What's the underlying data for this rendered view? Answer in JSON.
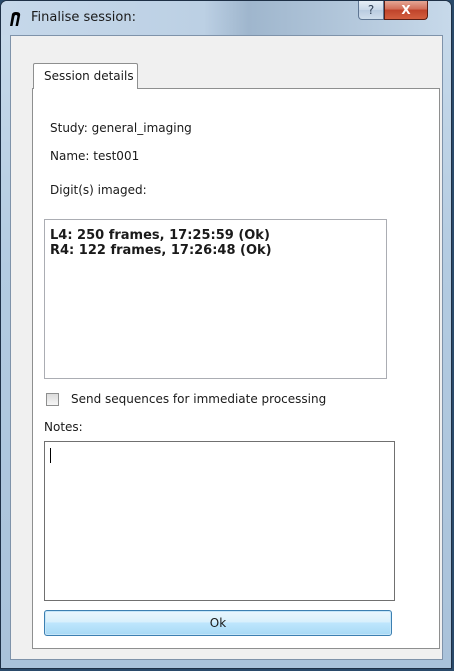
{
  "window": {
    "title": "Finalise session:",
    "app_icon": "n-logo-icon",
    "help_label": "?",
    "close_label": "X"
  },
  "tabs": [
    {
      "label": "Session details",
      "active": true
    }
  ],
  "session": {
    "study": "Study: general_imaging",
    "name": "Name: test001",
    "digits_label": "Digit(s) imaged:",
    "digits": [
      "L4: 250 frames, 17:25:59 (Ok)",
      "R4: 122 frames, 17:26:48 (Ok)"
    ],
    "send_checkbox_label": "Send sequences for immediate processing",
    "send_checked": false,
    "notes_label": "Notes:",
    "notes_value": ""
  },
  "actions": {
    "ok_label": "Ok"
  },
  "colors": {
    "titlebar": "#c6d8ea",
    "close_button": "#c0432b",
    "ok_button": "#bee6fd"
  }
}
